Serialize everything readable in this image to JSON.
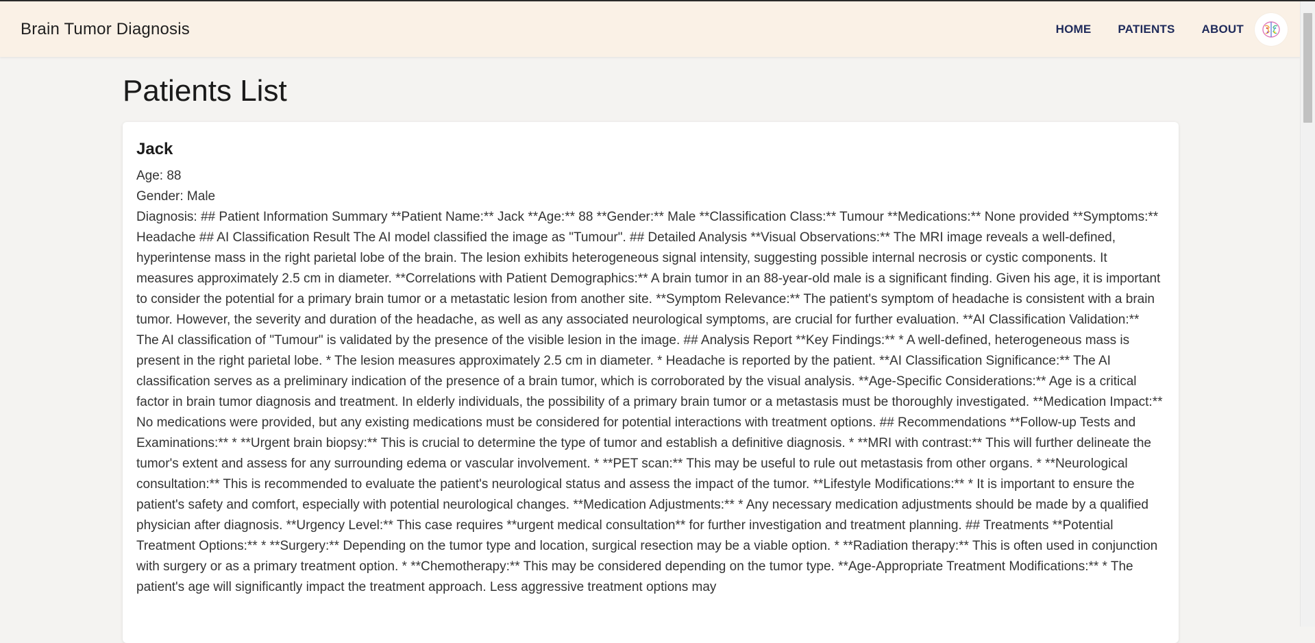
{
  "brand": "Brain Tumor Diagnosis",
  "nav": {
    "home": "HOME",
    "patients": "PATIENTS",
    "about": "ABOUT"
  },
  "page_title": "Patients List",
  "patient": {
    "name": "Jack",
    "age_line": "Age: 88",
    "gender_line": "Gender: Male",
    "diagnosis_line": "Diagnosis: ## Patient Information Summary **Patient Name:** Jack **Age:** 88 **Gender:** Male **Classification Class:** Tumour **Medications:** None provided **Symptoms:** Headache ## AI Classification Result The AI model classified the image as \"Tumour\". ## Detailed Analysis **Visual Observations:** The MRI image reveals a well-defined, hyperintense mass in the right parietal lobe of the brain. The lesion exhibits heterogeneous signal intensity, suggesting possible internal necrosis or cystic components. It measures approximately 2.5 cm in diameter. **Correlations with Patient Demographics:** A brain tumor in an 88-year-old male is a significant finding. Given his age, it is important to consider the potential for a primary brain tumor or a metastatic lesion from another site. **Symptom Relevance:** The patient's symptom of headache is consistent with a brain tumor. However, the severity and duration of the headache, as well as any associated neurological symptoms, are crucial for further evaluation. **AI Classification Validation:** The AI classification of \"Tumour\" is validated by the presence of the visible lesion in the image. ## Analysis Report **Key Findings:** * A well-defined, heterogeneous mass is present in the right parietal lobe. * The lesion measures approximately 2.5 cm in diameter. * Headache is reported by the patient. **AI Classification Significance:** The AI classification serves as a preliminary indication of the presence of a brain tumor, which is corroborated by the visual analysis. **Age-Specific Considerations:** Age is a critical factor in brain tumor diagnosis and treatment. In elderly individuals, the possibility of a primary brain tumor or a metastasis must be thoroughly investigated. **Medication Impact:** No medications were provided, but any existing medications must be considered for potential interactions with treatment options. ## Recommendations **Follow-up Tests and Examinations:** * **Urgent brain biopsy:** This is crucial to determine the type of tumor and establish a definitive diagnosis. * **MRI with contrast:** This will further delineate the tumor's extent and assess for any surrounding edema or vascular involvement. * **PET scan:** This may be useful to rule out metastasis from other organs. * **Neurological consultation:** This is recommended to evaluate the patient's neurological status and assess the impact of the tumor. **Lifestyle Modifications:** * It is important to ensure the patient's safety and comfort, especially with potential neurological changes. **Medication Adjustments:** * Any necessary medication adjustments should be made by a qualified physician after diagnosis. **Urgency Level:** This case requires **urgent medical consultation** for further investigation and treatment planning. ## Treatments **Potential Treatment Options:** * **Surgery:** Depending on the tumor type and location, surgical resection may be a viable option. * **Radiation therapy:** This is often used in conjunction with surgery or as a primary treatment option. * **Chemotherapy:** This may be considered depending on the tumor type. **Age-Appropriate Treatment Modifications:** * The patient's age will significantly impact the treatment approach. Less aggressive treatment options may"
  },
  "icons": {
    "avatar": "brain-logo-icon"
  },
  "colors": {
    "navbar_bg": "#faf1e6",
    "nav_link": "#1e2a5a",
    "page_bg": "#f4f3f1"
  }
}
